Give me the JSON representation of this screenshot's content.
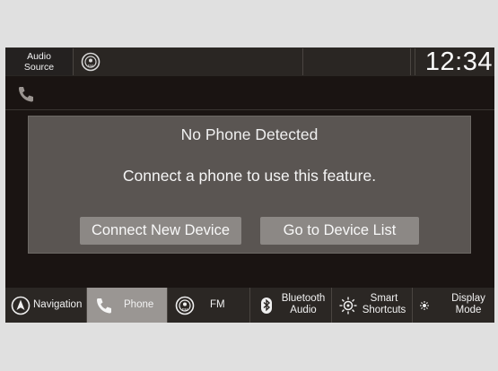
{
  "status_bar": {
    "audio_source_line1": "Audio",
    "audio_source_line2": "Source",
    "clock": "12:34"
  },
  "dialog": {
    "title": "No Phone Detected",
    "message": "Connect a phone to use this feature.",
    "buttons": {
      "connect_new_device": "Connect New Device",
      "go_to_device_list": "Go to Device List"
    }
  },
  "bottom_nav": {
    "navigation": "Navigation",
    "phone": "Phone",
    "fm": "FM",
    "bluetooth_line1": "Bluetooth",
    "bluetooth_line2": "Audio",
    "smart_line1": "Smart",
    "smart_line2": "Shortcuts",
    "display_line1": "Display",
    "display_line2": "Mode",
    "active_item": "phone"
  },
  "colors": {
    "screen_bg": "#1a1412",
    "dialog_bg": "#5a5552",
    "button_bg": "#8c8885",
    "active_tab_bg": "#9a9693"
  },
  "icons": [
    "fm-radio-icon",
    "phone-icon",
    "navigation-compass-icon",
    "bluetooth-icon",
    "smart-shortcuts-icon",
    "display-mode-icon"
  ]
}
